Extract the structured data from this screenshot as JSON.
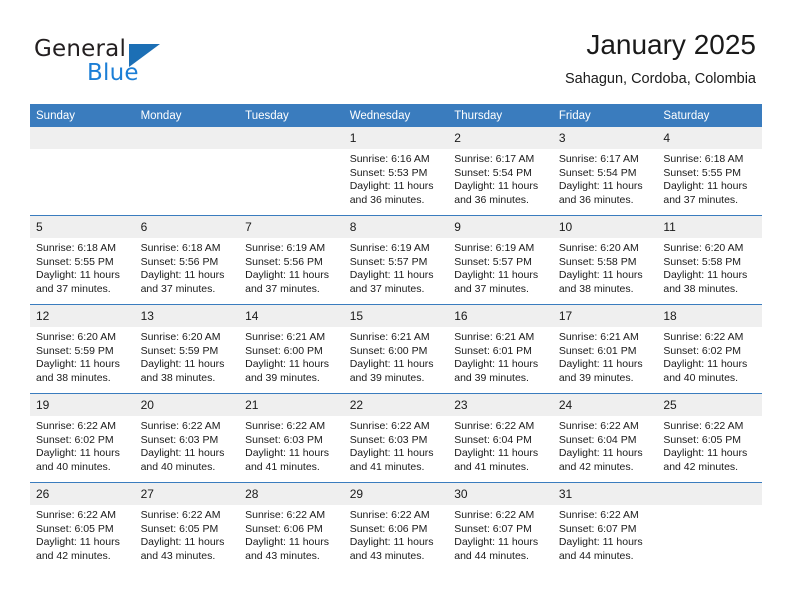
{
  "brand": {
    "name_top": "General",
    "name_bottom": "Blue",
    "triangle_icon": "triangle-icon",
    "color_dark": "#231f20",
    "color_blue": "#1b7ed6"
  },
  "header": {
    "title": "January 2025",
    "subtitle": "Sahagun, Cordoba, Colombia"
  },
  "theme": {
    "header_bg": "#3a7cbe",
    "daynum_bg": "#efefef",
    "text": "#1a1a1a"
  },
  "weekdays": [
    "Sunday",
    "Monday",
    "Tuesday",
    "Wednesday",
    "Thursday",
    "Friday",
    "Saturday"
  ],
  "weeks": [
    [
      {
        "day": "",
        "empty": true
      },
      {
        "day": "",
        "empty": true
      },
      {
        "day": "",
        "empty": true
      },
      {
        "day": "1",
        "sunrise": "Sunrise: 6:16 AM",
        "sunset": "Sunset: 5:53 PM",
        "daylight1": "Daylight: 11 hours",
        "daylight2": "and 36 minutes."
      },
      {
        "day": "2",
        "sunrise": "Sunrise: 6:17 AM",
        "sunset": "Sunset: 5:54 PM",
        "daylight1": "Daylight: 11 hours",
        "daylight2": "and 36 minutes."
      },
      {
        "day": "3",
        "sunrise": "Sunrise: 6:17 AM",
        "sunset": "Sunset: 5:54 PM",
        "daylight1": "Daylight: 11 hours",
        "daylight2": "and 36 minutes."
      },
      {
        "day": "4",
        "sunrise": "Sunrise: 6:18 AM",
        "sunset": "Sunset: 5:55 PM",
        "daylight1": "Daylight: 11 hours",
        "daylight2": "and 37 minutes."
      }
    ],
    [
      {
        "day": "5",
        "sunrise": "Sunrise: 6:18 AM",
        "sunset": "Sunset: 5:55 PM",
        "daylight1": "Daylight: 11 hours",
        "daylight2": "and 37 minutes."
      },
      {
        "day": "6",
        "sunrise": "Sunrise: 6:18 AM",
        "sunset": "Sunset: 5:56 PM",
        "daylight1": "Daylight: 11 hours",
        "daylight2": "and 37 minutes."
      },
      {
        "day": "7",
        "sunrise": "Sunrise: 6:19 AM",
        "sunset": "Sunset: 5:56 PM",
        "daylight1": "Daylight: 11 hours",
        "daylight2": "and 37 minutes."
      },
      {
        "day": "8",
        "sunrise": "Sunrise: 6:19 AM",
        "sunset": "Sunset: 5:57 PM",
        "daylight1": "Daylight: 11 hours",
        "daylight2": "and 37 minutes."
      },
      {
        "day": "9",
        "sunrise": "Sunrise: 6:19 AM",
        "sunset": "Sunset: 5:57 PM",
        "daylight1": "Daylight: 11 hours",
        "daylight2": "and 37 minutes."
      },
      {
        "day": "10",
        "sunrise": "Sunrise: 6:20 AM",
        "sunset": "Sunset: 5:58 PM",
        "daylight1": "Daylight: 11 hours",
        "daylight2": "and 38 minutes."
      },
      {
        "day": "11",
        "sunrise": "Sunrise: 6:20 AM",
        "sunset": "Sunset: 5:58 PM",
        "daylight1": "Daylight: 11 hours",
        "daylight2": "and 38 minutes."
      }
    ],
    [
      {
        "day": "12",
        "sunrise": "Sunrise: 6:20 AM",
        "sunset": "Sunset: 5:59 PM",
        "daylight1": "Daylight: 11 hours",
        "daylight2": "and 38 minutes."
      },
      {
        "day": "13",
        "sunrise": "Sunrise: 6:20 AM",
        "sunset": "Sunset: 5:59 PM",
        "daylight1": "Daylight: 11 hours",
        "daylight2": "and 38 minutes."
      },
      {
        "day": "14",
        "sunrise": "Sunrise: 6:21 AM",
        "sunset": "Sunset: 6:00 PM",
        "daylight1": "Daylight: 11 hours",
        "daylight2": "and 39 minutes."
      },
      {
        "day": "15",
        "sunrise": "Sunrise: 6:21 AM",
        "sunset": "Sunset: 6:00 PM",
        "daylight1": "Daylight: 11 hours",
        "daylight2": "and 39 minutes."
      },
      {
        "day": "16",
        "sunrise": "Sunrise: 6:21 AM",
        "sunset": "Sunset: 6:01 PM",
        "daylight1": "Daylight: 11 hours",
        "daylight2": "and 39 minutes."
      },
      {
        "day": "17",
        "sunrise": "Sunrise: 6:21 AM",
        "sunset": "Sunset: 6:01 PM",
        "daylight1": "Daylight: 11 hours",
        "daylight2": "and 39 minutes."
      },
      {
        "day": "18",
        "sunrise": "Sunrise: 6:22 AM",
        "sunset": "Sunset: 6:02 PM",
        "daylight1": "Daylight: 11 hours",
        "daylight2": "and 40 minutes."
      }
    ],
    [
      {
        "day": "19",
        "sunrise": "Sunrise: 6:22 AM",
        "sunset": "Sunset: 6:02 PM",
        "daylight1": "Daylight: 11 hours",
        "daylight2": "and 40 minutes."
      },
      {
        "day": "20",
        "sunrise": "Sunrise: 6:22 AM",
        "sunset": "Sunset: 6:03 PM",
        "daylight1": "Daylight: 11 hours",
        "daylight2": "and 40 minutes."
      },
      {
        "day": "21",
        "sunrise": "Sunrise: 6:22 AM",
        "sunset": "Sunset: 6:03 PM",
        "daylight1": "Daylight: 11 hours",
        "daylight2": "and 41 minutes."
      },
      {
        "day": "22",
        "sunrise": "Sunrise: 6:22 AM",
        "sunset": "Sunset: 6:03 PM",
        "daylight1": "Daylight: 11 hours",
        "daylight2": "and 41 minutes."
      },
      {
        "day": "23",
        "sunrise": "Sunrise: 6:22 AM",
        "sunset": "Sunset: 6:04 PM",
        "daylight1": "Daylight: 11 hours",
        "daylight2": "and 41 minutes."
      },
      {
        "day": "24",
        "sunrise": "Sunrise: 6:22 AM",
        "sunset": "Sunset: 6:04 PM",
        "daylight1": "Daylight: 11 hours",
        "daylight2": "and 42 minutes."
      },
      {
        "day": "25",
        "sunrise": "Sunrise: 6:22 AM",
        "sunset": "Sunset: 6:05 PM",
        "daylight1": "Daylight: 11 hours",
        "daylight2": "and 42 minutes."
      }
    ],
    [
      {
        "day": "26",
        "sunrise": "Sunrise: 6:22 AM",
        "sunset": "Sunset: 6:05 PM",
        "daylight1": "Daylight: 11 hours",
        "daylight2": "and 42 minutes."
      },
      {
        "day": "27",
        "sunrise": "Sunrise: 6:22 AM",
        "sunset": "Sunset: 6:05 PM",
        "daylight1": "Daylight: 11 hours",
        "daylight2": "and 43 minutes."
      },
      {
        "day": "28",
        "sunrise": "Sunrise: 6:22 AM",
        "sunset": "Sunset: 6:06 PM",
        "daylight1": "Daylight: 11 hours",
        "daylight2": "and 43 minutes."
      },
      {
        "day": "29",
        "sunrise": "Sunrise: 6:22 AM",
        "sunset": "Sunset: 6:06 PM",
        "daylight1": "Daylight: 11 hours",
        "daylight2": "and 43 minutes."
      },
      {
        "day": "30",
        "sunrise": "Sunrise: 6:22 AM",
        "sunset": "Sunset: 6:07 PM",
        "daylight1": "Daylight: 11 hours",
        "daylight2": "and 44 minutes."
      },
      {
        "day": "31",
        "sunrise": "Sunrise: 6:22 AM",
        "sunset": "Sunset: 6:07 PM",
        "daylight1": "Daylight: 11 hours",
        "daylight2": "and 44 minutes."
      },
      {
        "day": "",
        "empty": true
      }
    ]
  ]
}
